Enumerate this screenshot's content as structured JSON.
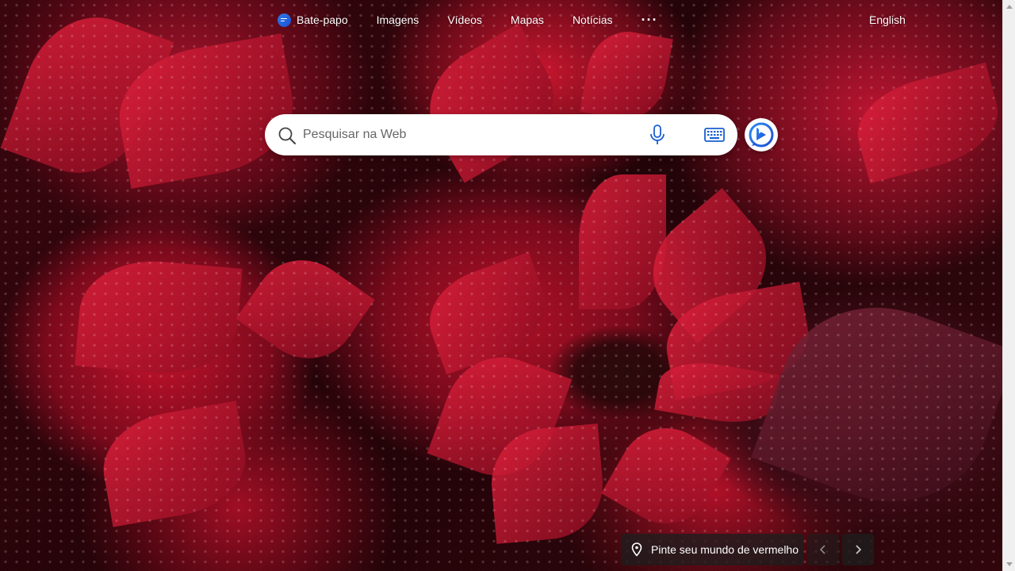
{
  "nav": {
    "chat_label": "Bate-papo",
    "images_label": "Imagens",
    "videos_label": "Vídeos",
    "maps_label": "Mapas",
    "news_label": "Notícias",
    "more_label": "···",
    "language_label": "English"
  },
  "search": {
    "placeholder": "Pesquisar na Web",
    "value": ""
  },
  "caption": {
    "text": "Pinte seu mundo de vermelho"
  },
  "icons": {
    "chat": "chat-bubble-icon",
    "search": "search-icon",
    "mic": "microphone-icon",
    "keyboard": "keyboard-icon",
    "copilot": "copilot-b-icon",
    "location": "location-pin-icon",
    "prev": "chevron-left-icon",
    "next": "chevron-right-icon"
  },
  "colors": {
    "accent_blue": "#1d4fd6",
    "background_red": "#b01026"
  }
}
